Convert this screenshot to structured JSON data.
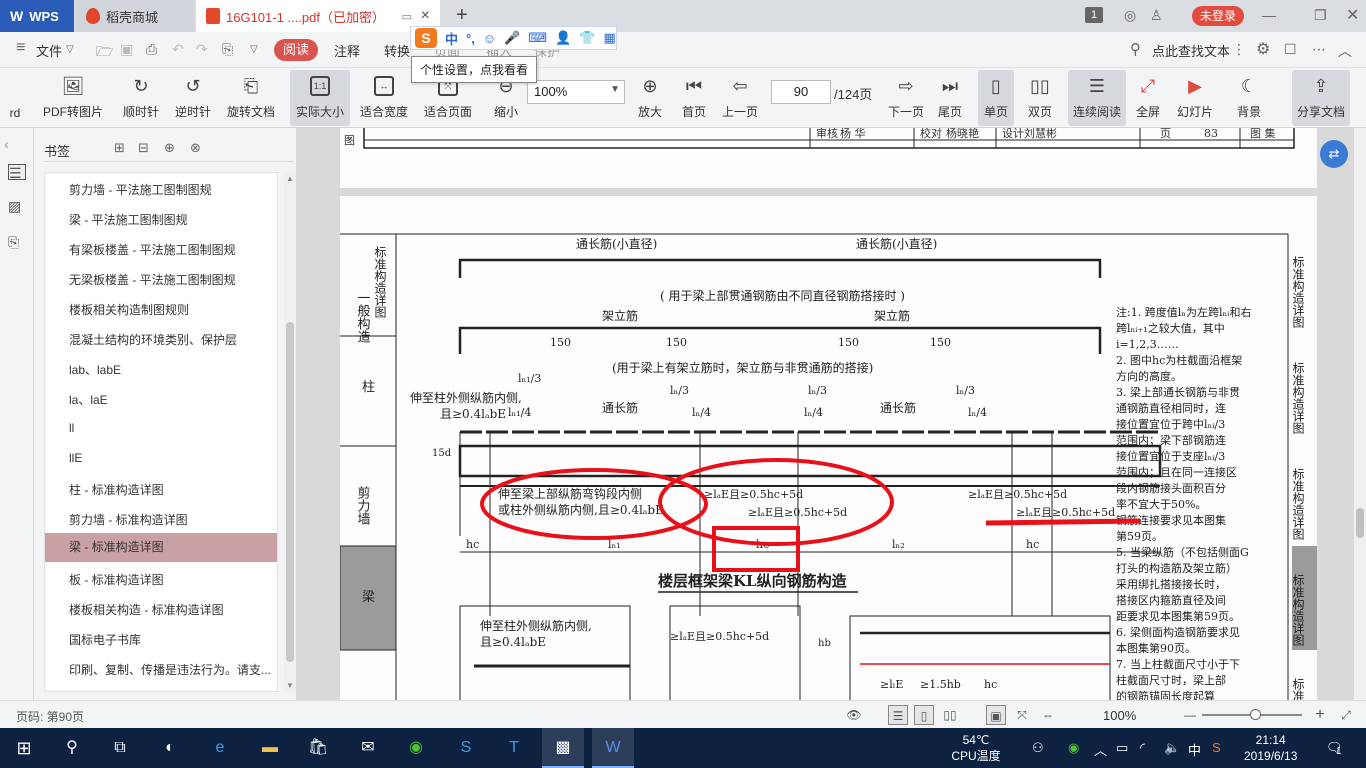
{
  "tabs": {
    "wps": "WPS",
    "store": "稻壳商城",
    "doc": "16G101-1 ....pdf（已加密）"
  },
  "window": {
    "badge": "1",
    "login": "未登录"
  },
  "menu": {
    "file": "文件",
    "read": "阅读",
    "annotate": "注释",
    "convert": "转换",
    "page": "页面",
    "insert": "插入",
    "protect": "保护",
    "search": "点此查找文本"
  },
  "ime": {
    "logo": "S",
    "lang": "中",
    "punct": "°,",
    "tooltip": "个性设置，点我看看"
  },
  "toolbar": {
    "rd": "rd",
    "pdf_to_image": "PDF转图片",
    "clockwise": "顺时针",
    "counter_clockwise": "逆时针",
    "rotate_doc": "旋转文档",
    "actual_size": "实际大小",
    "actual_size_icon": "1:1",
    "fit_width": "适合宽度",
    "fit_page": "适合页面",
    "zoom_out": "缩小",
    "zoom_value": "100%",
    "zoom_in": "放大",
    "first_page": "首页",
    "prev_page": "上一页",
    "current_page": "90",
    "total_pages": "/124页",
    "next_page": "下一页",
    "last_page": "尾页",
    "single_page": "单页",
    "double_page": "双页",
    "continuous": "连续阅读",
    "fullscreen": "全屏",
    "slideshow": "幻灯片",
    "background": "背景",
    "share": "分享文档"
  },
  "bookmarks": {
    "title": "书签",
    "items": [
      "剪力墙 - 平法施工图制图规",
      "梁 - 平法施工图制图规",
      "有梁板楼盖 - 平法施工图制图规",
      "无梁板楼盖 - 平法施工图制图规",
      "楼板相关构造制图规则",
      "混凝土结构的环境类别、保护层",
      "lab、labE",
      "la、laE",
      "ll",
      "llE",
      "柱 - 标准构造详图",
      "剪力墙 - 标准构造详图",
      "梁 - 标准构造详图",
      "板 - 标准构造详图",
      "楼板相关构造 - 标准构造详图",
      "国标电子书库",
      "印刷、复制、传播是违法行为。请支..."
    ],
    "selected_index": 12
  },
  "doc": {
    "prev_page_footer": {
      "shen": "审核",
      "shen_name": "杨 华",
      "jiao": "校对",
      "jiao_name": "杨晓艳",
      "she": "设计",
      "she_name": "刘慧彬",
      "ye": "页",
      "page_no": "83",
      "tu": "图",
      "tujie": "图 集"
    },
    "side_left": [
      "标准构造详图",
      "柱",
      "剪力墙",
      "梁"
    ],
    "side_left_top": "一般构造",
    "side_right": [
      "标准构造详图",
      "标准构造详图",
      "标准构造详图",
      "标准构造详图",
      "标准构造详图"
    ],
    "labels": {
      "tongchang_small_1": "通长筋(小直径)",
      "tongchang_small_2": "通长筋(小直径)",
      "lle": "lₗE",
      "note1": "( 用于梁上部贯通钢筋由不同直径钢筋搭接时 )",
      "jiali": "架立筋",
      "n150": "150",
      "note2": "(用于梁上有架立筋时，架立筋与非贯通筋的搭接)",
      "ln1_3": "lₙ₁/3",
      "ln_3": "lₙ/3",
      "ln_4": "lₙ/4",
      "ln1_4": "lₙ₁/4",
      "extend1": "伸至柱外侧纵筋内侧,",
      "extend2": "且≥0.4lₐbE",
      "tongchang": "通长筋",
      "bend1": "伸至梁上部纵筋弯钩段内侧",
      "bend2": "或柱外侧纵筋内侧,且≥0.4lₐbE",
      "lae1": "≥lₐE且≥0.5hc+5d",
      "hc": "hc",
      "ln1": "lₙ₁",
      "ln2": "lₙ₂",
      "n15d": "15d",
      "title": "楼层框架梁KL纵向钢筋构造",
      "extend3": "伸至柱外侧纵筋内侧,",
      "extend4": "且≥0.4lₐbE",
      "lae2": "≥lₐE且≥0.5hc+5d",
      "hb": "hb",
      "lle2": "≥lₗE",
      "h15": "≥1.5hb",
      "hc2": "hc"
    },
    "notes": [
      "注:1. 跨度值lₙ为左跨lₙᵢ和右",
      "跨lₙᵢ₊₁之较大值，其中",
      "i=1,2,3……",
      "2. 图中hc为柱截面沿框架",
      "方向的高度。",
      "3. 梁上部通长钢筋与非贯",
      "通钢筋直径相同时，连",
      "接位置宜位于跨中lₙᵢ/3",
      "范围内；梁下部钢筋连",
      "接位置宜位于支座lₙᵢ/3",
      "范围内；且在同一连接区",
      "段内钢筋接头面积百分",
      "率不宜大于50%。",
      "钢筋连接要求见本图集",
      "第59页。",
      "5. 当梁纵筋（不包括侧面G",
      "打头的构造筋及架立筋）",
      "采用绑扎搭接接长时，",
      "搭接区内箍筋直径及间",
      "距要求见本图集第59页。",
      "6. 梁侧面构造钢筋要求见",
      "本图集第90页。",
      "7. 当上柱截面尺寸小于下",
      "柱截面尺寸时，梁上部",
      "的钢筋锚固长度起算"
    ]
  },
  "status": {
    "page_label": "页码: 第90页",
    "zoom": "100%"
  },
  "taskbar": {
    "temp": "54℃",
    "temp_label": "CPU温度",
    "ime_lang": "中",
    "time": "21:14",
    "date": "2019/6/13",
    "notif": "1"
  },
  "colors": {
    "accent_red": "#d9534f",
    "wps_blue": "#2a5cb8",
    "annotation_red": "#e8111a",
    "selected_bookmark": "#c9a0a3"
  }
}
